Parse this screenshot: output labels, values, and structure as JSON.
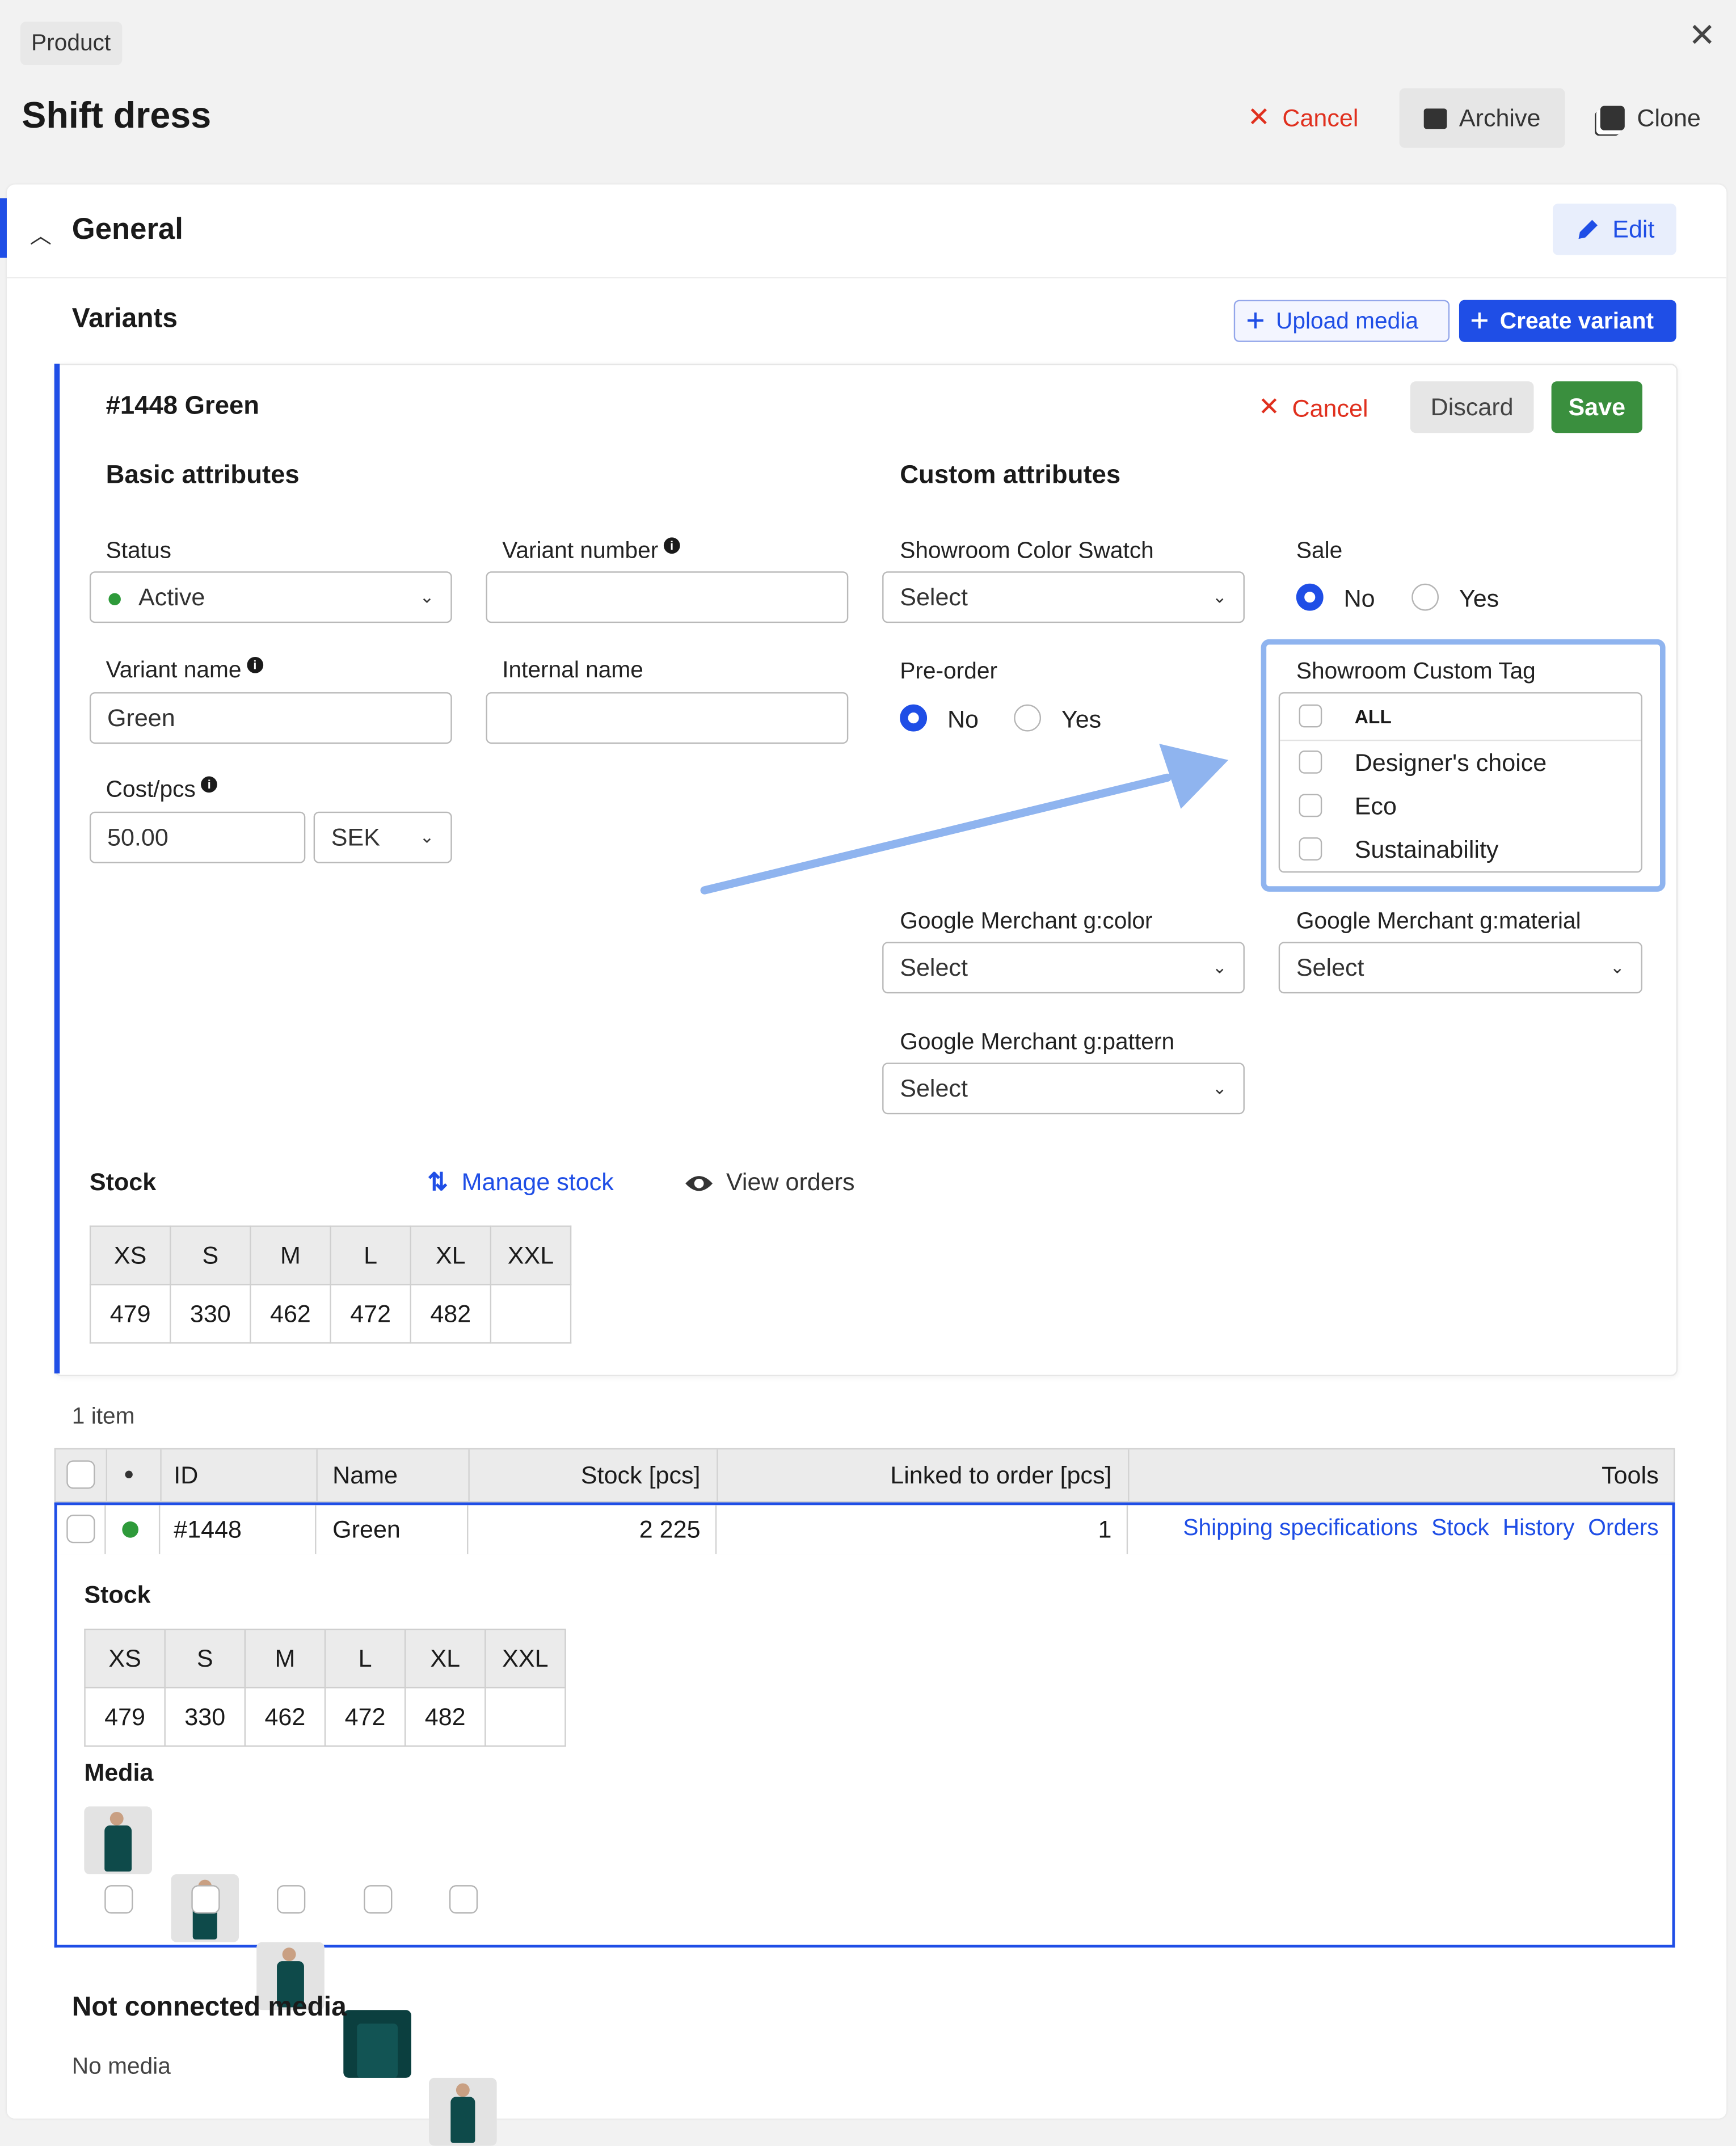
{
  "header": {
    "tag": "Product",
    "title": "Shift dress",
    "cancel": "Cancel",
    "archive": "Archive",
    "clone": "Clone"
  },
  "general": {
    "title": "General",
    "edit": "Edit"
  },
  "variants": {
    "title": "Variants",
    "upload_media": "Upload media",
    "create_variant": "Create variant"
  },
  "variant_card": {
    "title": "#1448 Green",
    "cancel": "Cancel",
    "discard": "Discard",
    "save": "Save",
    "basic_title": "Basic attributes",
    "custom_title": "Custom attributes",
    "status_label": "Status",
    "status_value": "Active",
    "variant_number_label": "Variant number",
    "variant_number_value": "",
    "variant_name_label": "Variant name",
    "variant_name_value": "Green",
    "internal_name_label": "Internal name",
    "internal_name_value": "",
    "cost_label": "Cost/pcs",
    "cost_value": "50.00",
    "currency": "SEK",
    "swatch_label": "Showroom Color Swatch",
    "swatch_value": "Select",
    "sale_label": "Sale",
    "sale_no": "No",
    "sale_yes": "Yes",
    "preorder_label": "Pre-order",
    "preorder_no": "No",
    "preorder_yes": "Yes",
    "tag_label": "Showroom Custom Tag",
    "tag_options": [
      "ALL",
      "Designer's choice",
      "Eco",
      "Sustainability"
    ],
    "gcolor_label": "Google Merchant g:color",
    "gcolor_value": "Select",
    "gmaterial_label": "Google Merchant g:material",
    "gmaterial_value": "Select",
    "gpattern_label": "Google Merchant g:pattern",
    "gpattern_value": "Select",
    "stock_label": "Stock",
    "manage_stock": "Manage stock",
    "view_orders": "View orders"
  },
  "stock_sizes": [
    "XS",
    "S",
    "M",
    "L",
    "XL",
    "XXL"
  ],
  "stock_values": [
    "479",
    "330",
    "462",
    "472",
    "482",
    ""
  ],
  "list": {
    "count": "1 item",
    "headers": {
      "dot": "●",
      "id": "ID",
      "name": "Name",
      "stock": "Stock [pcs]",
      "linked": "Linked to order [pcs]",
      "tools": "Tools"
    },
    "row": {
      "id": "#1448",
      "name": "Green",
      "stock": "2 225",
      "linked": "1",
      "tools": [
        "Shipping specifications",
        "Stock",
        "History",
        "Orders"
      ]
    },
    "expanded": {
      "stock_title": "Stock",
      "media_title": "Media"
    }
  },
  "not_connected": {
    "title": "Not connected media",
    "text": "No media"
  },
  "colors": {
    "accent": "#1f4ee6",
    "danger": "#e0301e",
    "success": "#3a8f3e",
    "highlight": "#8fb4ef",
    "status_dot": "#2e9a3a"
  }
}
